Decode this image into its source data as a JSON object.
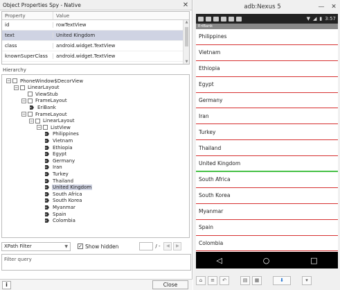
{
  "left": {
    "title": "Object Properties Spy - Native",
    "close_glyph": "✕",
    "props": {
      "headers": [
        "Property",
        "Value"
      ],
      "rows": [
        {
          "p": "id",
          "v": "rowTextView"
        },
        {
          "p": "text",
          "v": "United Kingdom"
        },
        {
          "p": "class",
          "v": "android.widget.TextView"
        },
        {
          "p": "knownSuperClass",
          "v": "android.widget.TextView"
        }
      ],
      "selected_row": 1
    },
    "hierarchy_label": "Hierarchy",
    "tree": [
      {
        "label": "PhoneWindow$DecorView",
        "depth": 0,
        "exp": true
      },
      {
        "label": "LinearLayout",
        "depth": 1,
        "exp": true
      },
      {
        "label": "ViewStub",
        "depth": 2,
        "exp": false
      },
      {
        "label": "FrameLayout",
        "depth": 2,
        "exp": true
      },
      {
        "label": "EriBank",
        "depth": 3,
        "leaf": true
      },
      {
        "label": "FrameLayout",
        "depth": 2,
        "exp": true
      },
      {
        "label": "LinearLayout",
        "depth": 3,
        "exp": true
      },
      {
        "label": "ListView",
        "depth": 4,
        "exp": true
      },
      {
        "label": "Philippines",
        "depth": 5,
        "leaf": true
      },
      {
        "label": "Vietnam",
        "depth": 5,
        "leaf": true
      },
      {
        "label": "Ethiopia",
        "depth": 5,
        "leaf": true
      },
      {
        "label": "Egypt",
        "depth": 5,
        "leaf": true
      },
      {
        "label": "Germany",
        "depth": 5,
        "leaf": true
      },
      {
        "label": "Iran",
        "depth": 5,
        "leaf": true
      },
      {
        "label": "Turkey",
        "depth": 5,
        "leaf": true
      },
      {
        "label": "Thailand",
        "depth": 5,
        "leaf": true
      },
      {
        "label": "United Kingdom",
        "depth": 5,
        "leaf": true,
        "selected": true
      },
      {
        "label": "South Africa",
        "depth": 5,
        "leaf": true
      },
      {
        "label": "South Korea",
        "depth": 5,
        "leaf": true
      },
      {
        "label": "Myanmar",
        "depth": 5,
        "leaf": true
      },
      {
        "label": "Spain",
        "depth": 5,
        "leaf": true
      },
      {
        "label": "Colombia",
        "depth": 5,
        "leaf": true
      }
    ],
    "filter": {
      "select_value": "XPath Filter",
      "show_hidden_label": "Show hidden",
      "show_hidden_checked": true,
      "page_of": "/ -",
      "query_placeholder": "Filter query"
    },
    "info_label": "i",
    "close_label": "Close"
  },
  "right": {
    "title": "adb:Nexus 5",
    "win_minimize": "—",
    "win_close": "✕",
    "time": "3:57",
    "app_title": "EriBank",
    "countries": [
      "Philippines",
      "Vietnam",
      "Ethiopia",
      "Egypt",
      "Germany",
      "Iran",
      "Turkey",
      "Thailand",
      "United Kingdom",
      "South Africa",
      "South Korea",
      "Myanmar",
      "Spain",
      "Colombia"
    ],
    "highlighted": "United Kingdom",
    "nav": {
      "back": "◁",
      "home": "○",
      "recent": "□"
    },
    "tools": [
      "home-icon",
      "menu-icon",
      "undo-icon",
      "layout-icon",
      "grid-icon",
      "download-icon",
      "more-icon"
    ]
  }
}
